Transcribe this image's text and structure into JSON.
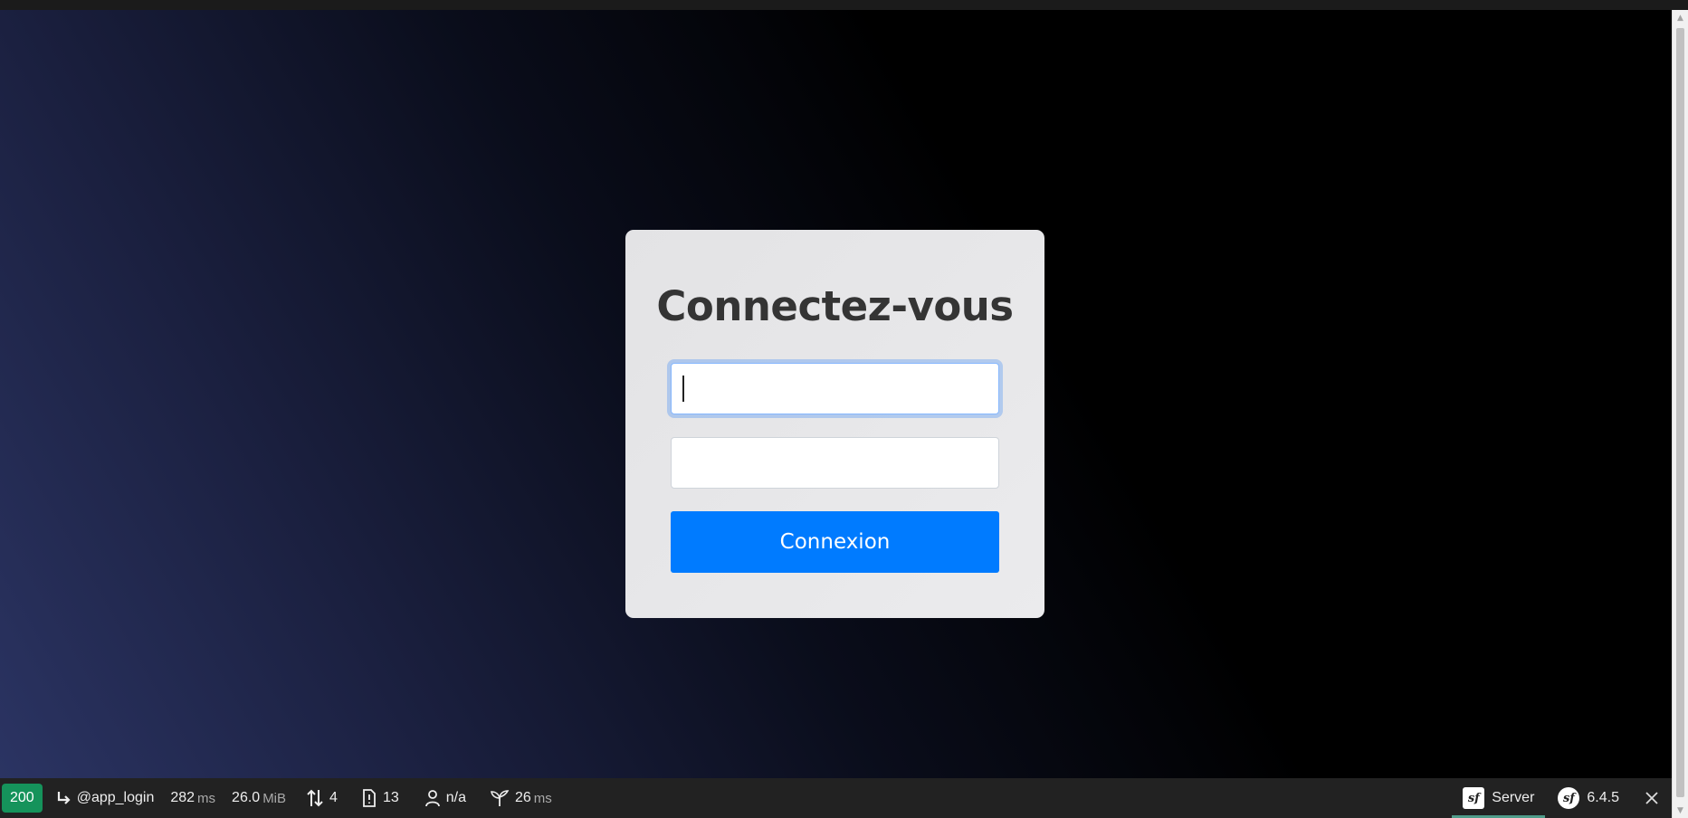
{
  "login": {
    "title": "Connectez-vous",
    "username": {
      "value": "",
      "placeholder": ""
    },
    "password": {
      "value": "",
      "placeholder": ""
    },
    "submit_label": "Connexion"
  },
  "toolbar": {
    "status_code": "200",
    "route": "@app_login",
    "time_value": "282",
    "time_unit": "ms",
    "memory_value": "26.0",
    "memory_unit": "MiB",
    "requests_count": "4",
    "logs_count": "13",
    "user": "n/a",
    "twig_value": "26",
    "twig_unit": "ms",
    "server_label": "Server",
    "symfony_version": "6.4.5"
  },
  "colors": {
    "button": "#007bff",
    "status_ok": "#15935b",
    "toolbar_bg": "#222222"
  }
}
